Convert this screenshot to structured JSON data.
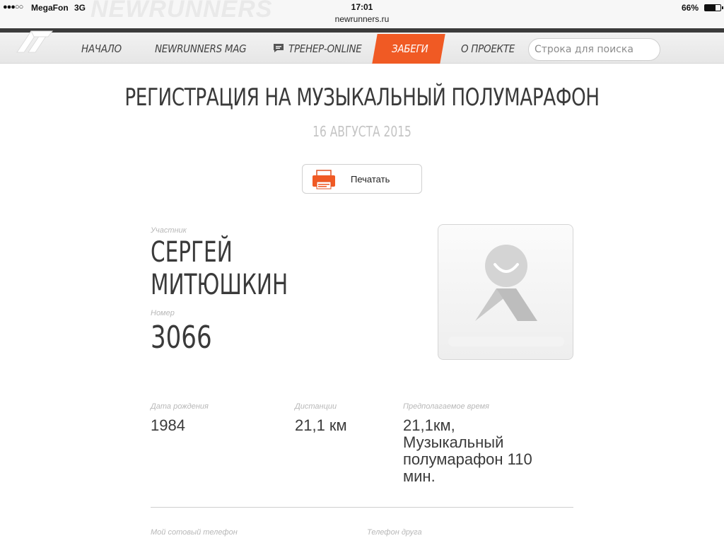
{
  "status_bar": {
    "signal": "●●●○○",
    "carrier": "MegaFon",
    "network": "3G",
    "time": "17:01",
    "url": "newrunners.ru",
    "battery_pct": "66%",
    "battery_level": 0.66
  },
  "watermark": "NEWRUNNERS",
  "nav": {
    "items": [
      {
        "label": "Начало",
        "active": false
      },
      {
        "label": "Newrunners mag",
        "active": false
      },
      {
        "label": "Тренер-online",
        "active": false,
        "icon": "chat-bubble-icon"
      },
      {
        "label": "Забеги",
        "active": true
      },
      {
        "label": "О проекте",
        "active": false
      }
    ],
    "search_placeholder": "Строка для поиска"
  },
  "page": {
    "title": "РЕГИСТРАЦИЯ НА МУЗЫКАЛЬНЫЙ ПОЛУМАРАФОН",
    "date": "16 АВГУСТА 2015",
    "print_label": "Печатать"
  },
  "participant": {
    "label": "Участник",
    "first_name": "Сергей",
    "last_name": "Митюшкин",
    "number_label": "Номер",
    "number": "3066"
  },
  "details": {
    "birth_label": "Дата рождения",
    "birth_value": "1984",
    "distance_label": "Дистанции",
    "distance_value": "21,1 км",
    "time_label": "Предполагаемое время",
    "time_line1": "21,1км,",
    "time_line2": "Музыкальный",
    "time_line3": "полумарафон 110",
    "time_line4": "мин."
  },
  "contacts": {
    "my_phone_label": "Мой сотовый телефон",
    "friend_phone_label": "Телефон друга"
  },
  "colors": {
    "accent": "#f05a24",
    "text": "#3a3a3a",
    "muted": "#b8b8b8"
  }
}
